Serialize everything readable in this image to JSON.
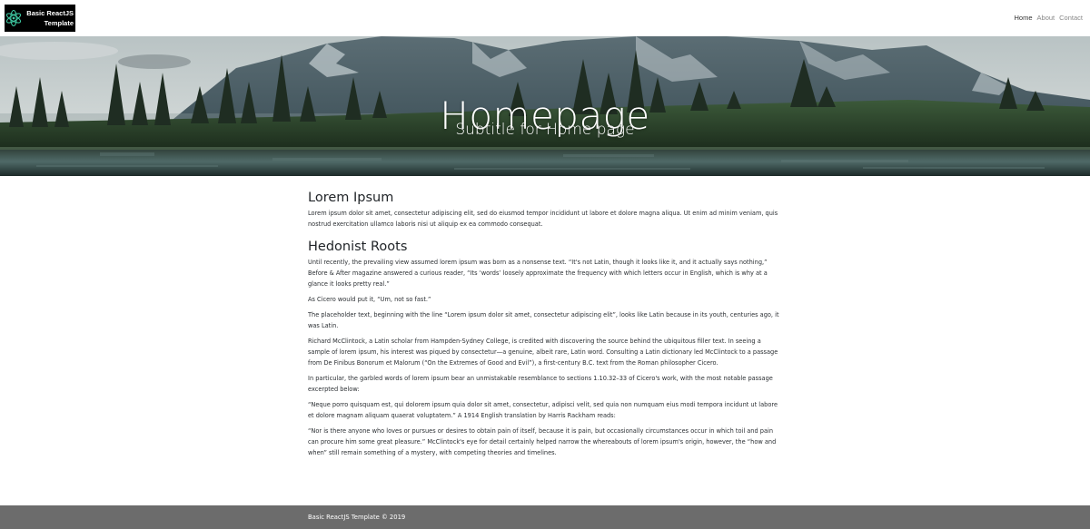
{
  "navbar": {
    "brand_line1": "Basic ReactJS",
    "brand_line2": "Template",
    "links": [
      "Home",
      "About",
      "Contact"
    ],
    "active_link": "Home",
    "brand_bg": "#000000",
    "logo_color": "#3ec7a0"
  },
  "hero": {
    "title": "Homepage",
    "subtitle": "Subtitle for Home page"
  },
  "main": {
    "section1": {
      "heading": "Lorem Ipsum",
      "paragraphs": [
        "Lorem ipsum dolor sit amet, consectetur adipiscing elit, sed do eiusmod tempor incididunt ut labore et dolore magna aliqua. Ut enim ad minim veniam, quis nostrud exercitation ullamco laboris nisi ut aliquip ex ea commodo consequat."
      ]
    },
    "section2": {
      "heading": "Hedonist Roots",
      "paragraphs": [
        "Until recently, the prevailing view assumed lorem ipsum was born as a nonsense text. “It's not Latin, though it looks like it, and it actually says nothing,” Before & After magazine answered a curious reader, “Its ‘words’ loosely approximate the frequency with which letters occur in English, which is why at a glance it looks pretty real.”",
        "As Cicero would put it, “Um, not so fast.”",
        "The placeholder text, beginning with the line “Lorem ipsum dolor sit amet, consectetur adipiscing elit”, looks like Latin because in its youth, centuries ago, it was Latin.",
        "Richard McClintock, a Latin scholar from Hampden-Sydney College, is credited with discovering the source behind the ubiquitous filler text. In seeing a sample of lorem ipsum, his interest was piqued by consectetur—a genuine, albeit rare, Latin word. Consulting a Latin dictionary led McClintock to a passage from De Finibus Bonorum et Malorum (“On the Extremes of Good and Evil”), a first-century B.C. text from the Roman philosopher Cicero.",
        "In particular, the garbled words of lorem ipsum bear an unmistakable resemblance to sections 1.10.32–33 of Cicero's work, with the most notable passage excerpted below:",
        "“Neque porro quisquam est, qui dolorem ipsum quia dolor sit amet, consectetur, adipisci velit, sed quia non numquam eius modi tempora incidunt ut labore et dolore magnam aliquam quaerat voluptatem.” A 1914 English translation by Harris Rackham reads:",
        "“Nor is there anyone who loves or pursues or desires to obtain pain of itself, because it is pain, but occasionally circumstances occur in which toil and pain can procure him some great pleasure.” McClintock's eye for detail certainly helped narrow the whereabouts of lorem ipsum's origin, however, the “how and when” still remain something of a mystery, with competing theories and timelines."
      ]
    }
  },
  "footer": {
    "text": "Basic ReactJS Template © 2019",
    "bg": "#6c6c6c"
  }
}
